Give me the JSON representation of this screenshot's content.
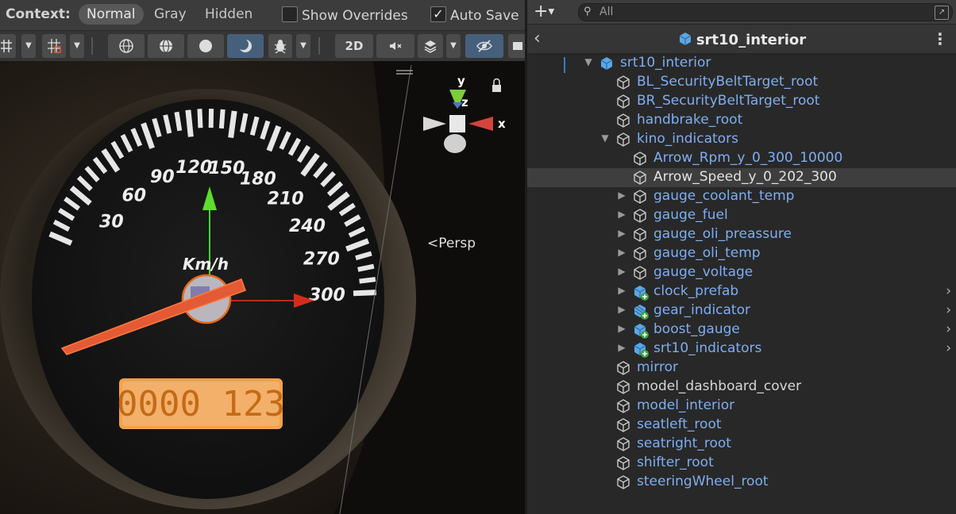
{
  "scene": {
    "context_label": "Context:",
    "context_modes": [
      "Normal",
      "Gray",
      "Hidden"
    ],
    "show_overrides": {
      "label": "Show Overrides",
      "checked": false
    },
    "auto_save": {
      "label": "Auto Save",
      "checked": true
    },
    "toolbar": {
      "mode_2d_label": "2D"
    },
    "persp_label": "Persp",
    "gizmo_axes": {
      "x": "x",
      "y": "y",
      "z": "z"
    },
    "speedometer": {
      "unit": "Km/h",
      "scale_labels": [
        "30",
        "60",
        "90",
        "120",
        "150",
        "180",
        "210",
        "240",
        "270",
        "300"
      ],
      "odometer": "0000 123"
    }
  },
  "hierarchy": {
    "search": {
      "placeholder": "All",
      "value": ""
    },
    "prefab_title": "srt10_interior",
    "items": [
      {
        "label": "srt10_interior",
        "indent": 0,
        "expanded": true,
        "icon": "prefab-root-icon"
      },
      {
        "label": "BL_SecurityBeltTarget_root",
        "indent": 1,
        "icon": "gameobject-icon"
      },
      {
        "label": "BR_SecurityBeltTarget_root",
        "indent": 1,
        "icon": "gameobject-icon"
      },
      {
        "label": "handbrake_root",
        "indent": 1,
        "icon": "gameobject-icon"
      },
      {
        "label": "kino_indicators",
        "indent": 1,
        "expanded": true,
        "icon": "gameobject-icon"
      },
      {
        "label": "Arrow_Rpm_y_0_300_10000",
        "indent": 2,
        "icon": "gameobject-icon"
      },
      {
        "label": "Arrow_Speed_y_0_202_300",
        "indent": 2,
        "icon": "gameobject-icon",
        "selected": true
      },
      {
        "label": "gauge_coolant_temp",
        "indent": 2,
        "expanded": false,
        "icon": "gameobject-icon"
      },
      {
        "label": "gauge_fuel",
        "indent": 2,
        "expanded": false,
        "icon": "gameobject-icon"
      },
      {
        "label": "gauge_oli_preassure",
        "indent": 2,
        "expanded": false,
        "icon": "gameobject-icon"
      },
      {
        "label": "gauge_oli_temp",
        "indent": 2,
        "expanded": false,
        "icon": "gameobject-icon"
      },
      {
        "label": "gauge_voltage",
        "indent": 2,
        "expanded": false,
        "icon": "gameobject-icon"
      },
      {
        "label": "clock_prefab",
        "indent": 2,
        "expanded": false,
        "icon": "prefab-added-icon",
        "nested": true
      },
      {
        "label": "gear_indicator",
        "indent": 2,
        "expanded": false,
        "icon": "prefab-variant-added-icon",
        "nested": true
      },
      {
        "label": "boost_gauge",
        "indent": 2,
        "expanded": false,
        "icon": "prefab-added-icon",
        "nested": true
      },
      {
        "label": "srt10_indicators",
        "indent": 2,
        "expanded": false,
        "icon": "prefab-added-icon",
        "nested": true
      },
      {
        "label": "mirror",
        "indent": 1,
        "icon": "gameobject-icon"
      },
      {
        "label": "model_dashboard_cover",
        "indent": 1,
        "icon": "gameobject-icon",
        "plain": true
      },
      {
        "label": "model_interior",
        "indent": 1,
        "icon": "gameobject-icon"
      },
      {
        "label": "seatleft_root",
        "indent": 1,
        "icon": "gameobject-icon"
      },
      {
        "label": "seatright_root",
        "indent": 1,
        "icon": "gameobject-icon"
      },
      {
        "label": "shifter_root",
        "indent": 1,
        "icon": "gameobject-icon"
      },
      {
        "label": "steeringWheel_root",
        "indent": 1,
        "icon": "gameobject-icon"
      }
    ]
  },
  "colors": {
    "accent": "#46607c",
    "link_blue": "#7eaef2",
    "odometer_bg": "#f6a14a",
    "needle": "#e45a35",
    "gizmo_y": "#5fdc2e",
    "gizmo_x": "#d82a1c"
  }
}
